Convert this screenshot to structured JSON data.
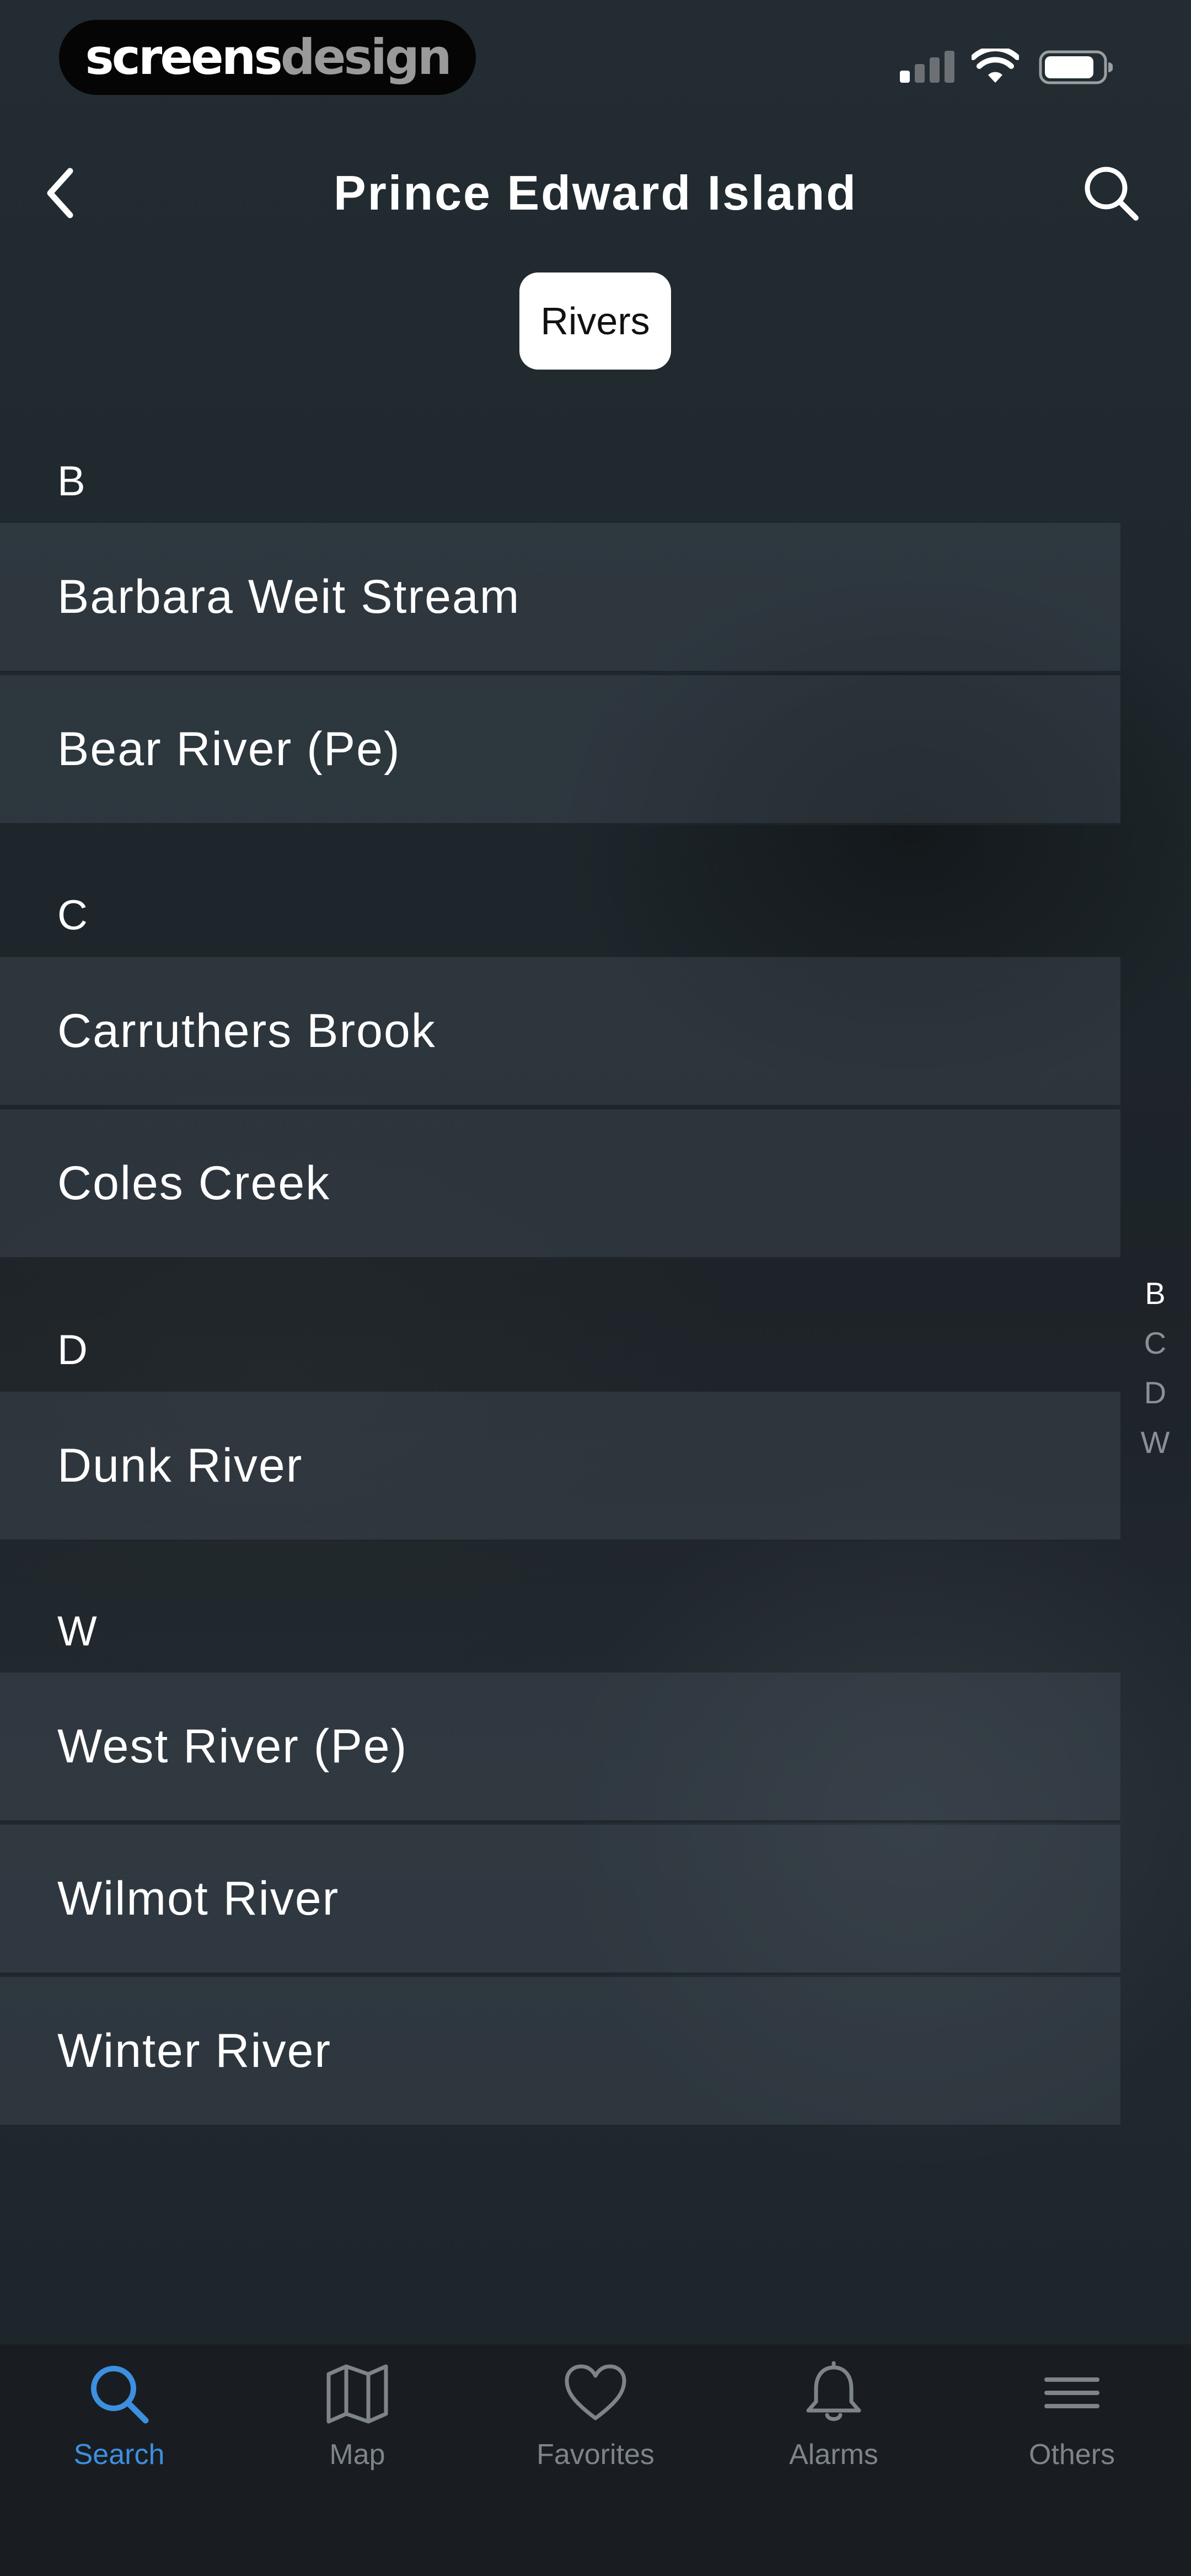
{
  "status_bar": {
    "brand_part1": "screens",
    "brand_part2": "design"
  },
  "header": {
    "title": "Prince Edward Island",
    "back_icon": "chevron-left-icon",
    "search_icon": "search-icon"
  },
  "filter": {
    "selected": "Rivers"
  },
  "sections": [
    {
      "letter": "B",
      "items": [
        "Barbara Weit Stream",
        "Bear River (Pe)"
      ]
    },
    {
      "letter": "C",
      "items": [
        "Carruthers Brook",
        "Coles Creek"
      ]
    },
    {
      "letter": "D",
      "items": [
        "Dunk River"
      ]
    },
    {
      "letter": "W",
      "items": [
        "West River (Pe)",
        "Wilmot River",
        "Winter River"
      ]
    }
  ],
  "index": [
    "B",
    "C",
    "D",
    "W"
  ],
  "tabs": [
    {
      "label": "Search",
      "icon": "search-icon",
      "active": true
    },
    {
      "label": "Map",
      "icon": "map-icon",
      "active": false
    },
    {
      "label": "Favorites",
      "icon": "heart-icon",
      "active": false
    },
    {
      "label": "Alarms",
      "icon": "bell-icon",
      "active": false
    },
    {
      "label": "Others",
      "icon": "menu-icon",
      "active": false
    }
  ],
  "colors": {
    "accent": "#3d8fe0",
    "inactive_tab": "#7d848a",
    "tab_bar_bg": "#191d21"
  }
}
